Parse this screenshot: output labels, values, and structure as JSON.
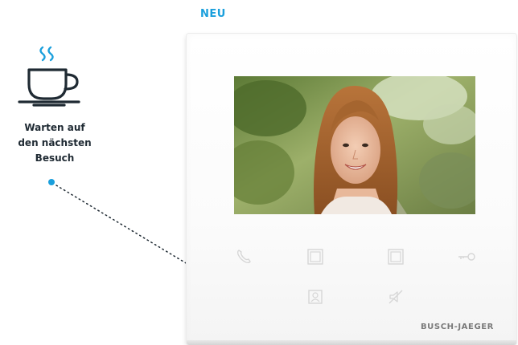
{
  "badge": {
    "label": "NEU"
  },
  "info": {
    "icon": "coffee-cup-icon",
    "lines": [
      "Warten auf",
      "den nächsten",
      "Besuch"
    ],
    "accent_color": "#1a9fdc"
  },
  "device": {
    "brand": "BUSCH-JAEGER",
    "buttons": [
      "phone-icon",
      "square-button-icon",
      "square-button-icon",
      "key-icon",
      "camera-icon",
      "mute-icon"
    ]
  }
}
